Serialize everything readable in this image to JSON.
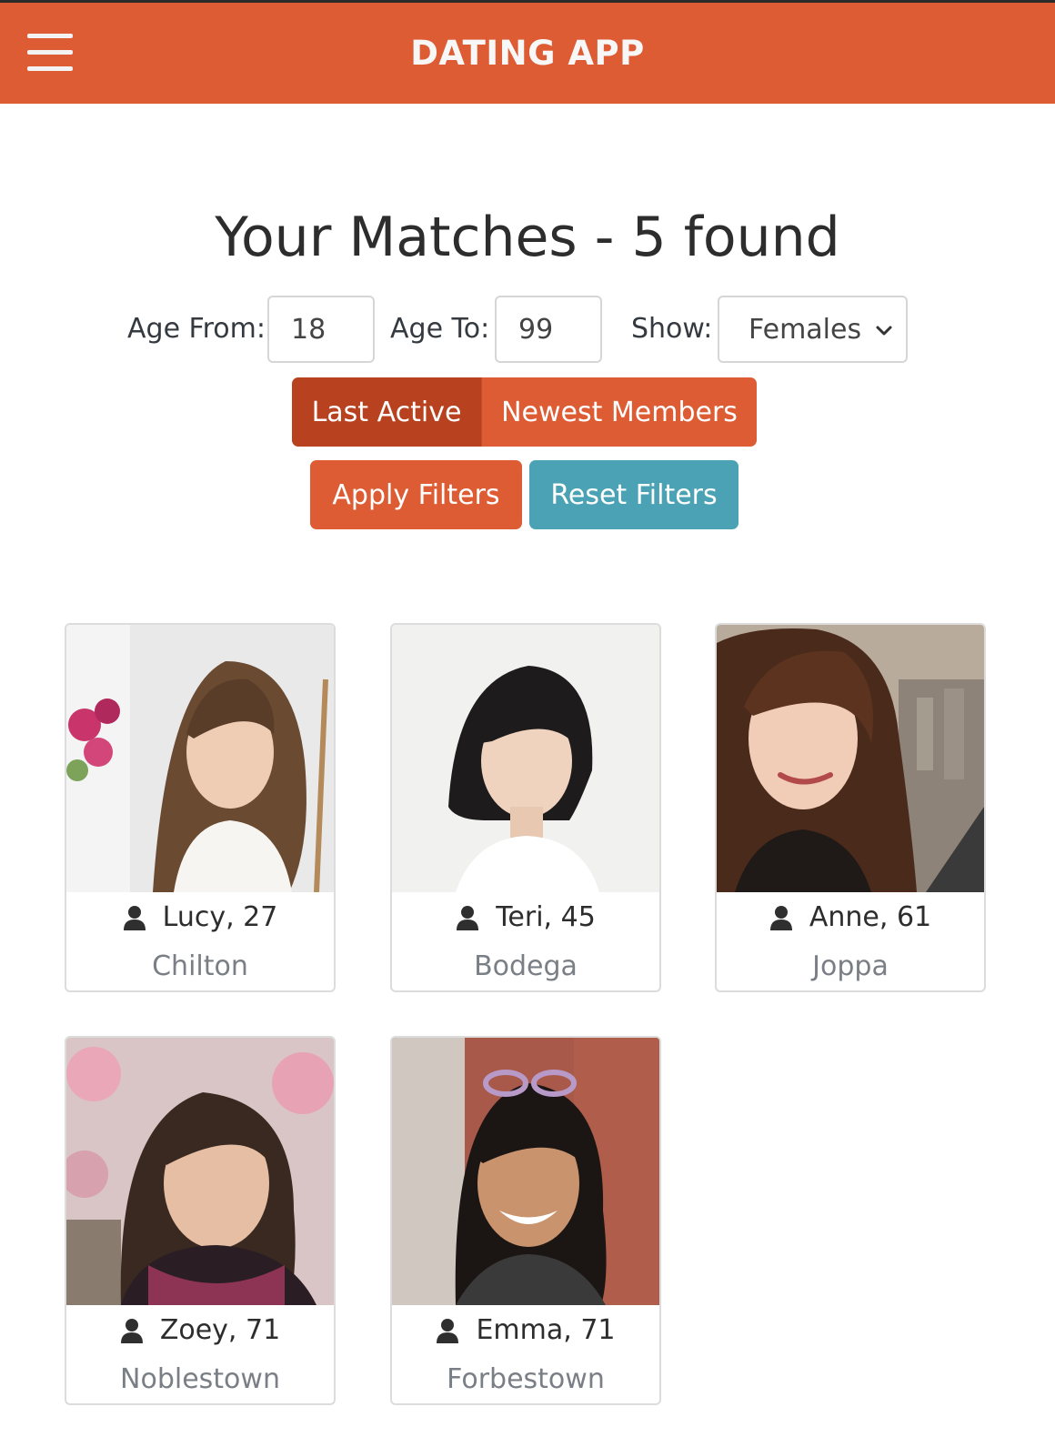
{
  "navbar": {
    "brand": "DATING APP",
    "menu_icon": "hamburger-menu-icon"
  },
  "heading": {
    "title": "Your Matches - 5 found"
  },
  "filters": {
    "age_from_label": "Age From:",
    "age_from_value": "18",
    "age_to_label": "Age To:",
    "age_to_value": "99",
    "show_label": "Show:",
    "show_value": "Females"
  },
  "sort_buttons": {
    "last_active": "Last Active",
    "newest_members": "Newest Members",
    "selected": "Last Active"
  },
  "actions": {
    "apply": "Apply Filters",
    "reset": "Reset Filters"
  },
  "colors": {
    "brand": "#dd5c33",
    "brand_dark": "#b8421f",
    "reset": "#4aa2b4"
  },
  "matches": [
    {
      "name_age": "Lucy, 27",
      "city": "Chilton",
      "icon": "user-icon"
    },
    {
      "name_age": "Teri, 45",
      "city": "Bodega",
      "icon": "user-icon"
    },
    {
      "name_age": "Anne, 61",
      "city": "Joppa",
      "icon": "user-icon"
    },
    {
      "name_age": "Zoey, 71",
      "city": "Noblestown",
      "icon": "user-icon"
    },
    {
      "name_age": "Emma, 71",
      "city": "Forbestown",
      "icon": "user-icon"
    }
  ]
}
